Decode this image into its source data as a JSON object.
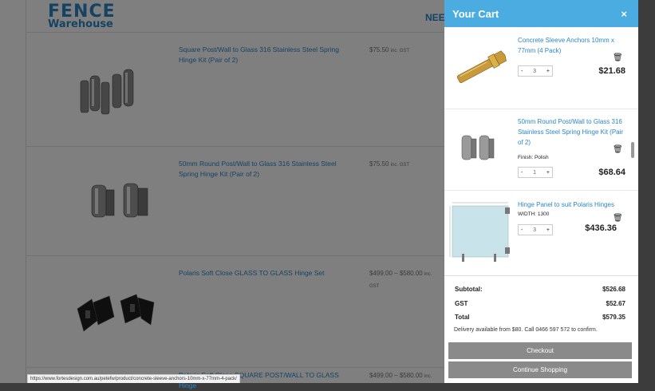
{
  "logo": {
    "line1": "FENCE",
    "line2": "Warehouse"
  },
  "nav": {
    "partial_text": "NEE"
  },
  "products": [
    {
      "name": "Square Post/Wall to Glass 316 Stainless Steel Spring Hinge Kit (Pair of 2)",
      "price": "$75.50",
      "price_suffix": "inc. GST"
    },
    {
      "name": "50mm Round Post/Wall to Glass 316 Stainless Steel Spring Hinge Kit (Pair of 2)",
      "price": "$75.50",
      "price_suffix": "inc. GST"
    },
    {
      "name": "Polaris Soft Close GLASS TO GLASS Hinge Set",
      "price": "$499.00 – $580.00",
      "price_suffix": "inc. GST"
    },
    {
      "name": "Polaris Soft Close SQUARE POST/WALL TO GLASS Hinge",
      "price": "$499.00 – $580.00",
      "price_suffix": "inc."
    }
  ],
  "status_url": "https://www.fortesdesign.com.au/petefw/product/concrete-sleeve-anchors-10mm-x-77mm-4-pack/",
  "cart": {
    "title": "Your Cart",
    "close": "×",
    "items": [
      {
        "name": "Concrete Sleeve Anchors 10mm x 77mm (4 Pack)",
        "attr": "",
        "qty": "3",
        "price": "$21.68"
      },
      {
        "name": "50mm Round Post/Wall to Glass 316 Stainless Steel Spring Hinge Kit (Pair of 2)",
        "attr": "Finish: Polish",
        "qty": "1",
        "price": "$68.64"
      },
      {
        "name": "Hinge Panel to suit Polaris Hinges",
        "attr": "WIDTH: 1300",
        "qty": "3",
        "price": "$436.36"
      }
    ],
    "qty_minus": "-",
    "qty_plus": "+",
    "subtotal_label": "Subtotal:",
    "subtotal": "$526.68",
    "gst_label": "GST",
    "gst": "$52.67",
    "total_label": "Total",
    "total": "$579.35",
    "delivery_note": "Delivery available from $80. Call 0466 597 572 to confirm.",
    "checkout": "Checkout",
    "continue": "Continue Shopping"
  },
  "colors": {
    "accent": "#4aace0",
    "link": "#2a86c9",
    "button": "#8a8a8a"
  }
}
